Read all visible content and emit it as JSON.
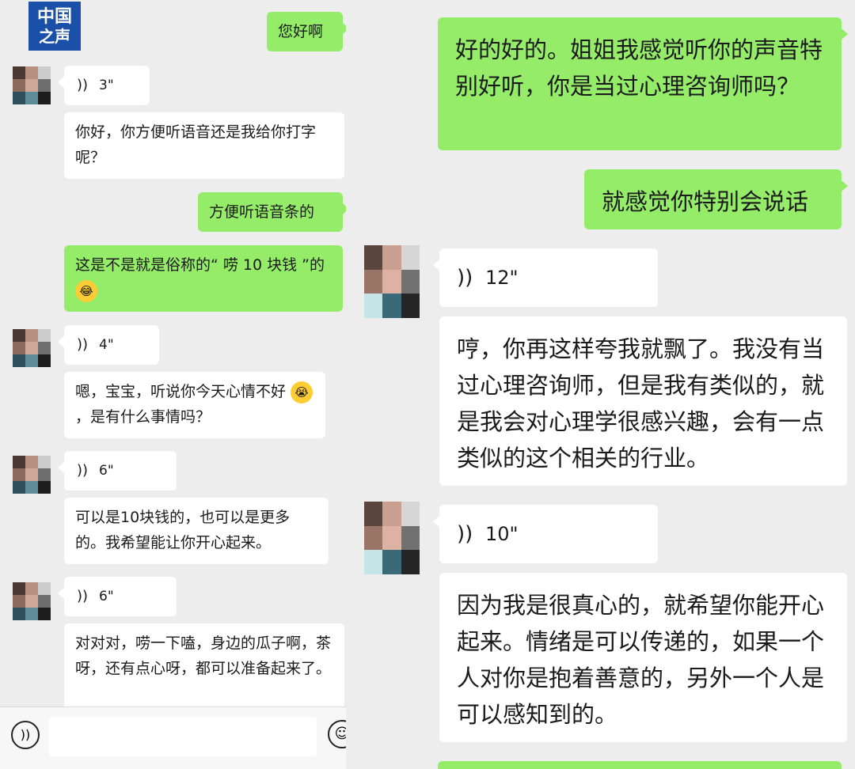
{
  "logo": {
    "line1": "中国",
    "line2": "之声"
  },
  "left_chat": {
    "msg1": "您好啊",
    "voice1": "3\"",
    "msg2": "你好，你方便听语音还是我给你打字呢？",
    "msg3": "方便听语音条的",
    "msg4_text": "这是不是就是俗称的“ 唠 10 块钱 ”的",
    "voice2": "4\"",
    "msg5_text": "嗯，宝宝，听说你今天心情不好",
    "msg5_text2": "，是有什么事情吗？",
    "voice3": "6\"",
    "msg6": "可以是10块钱的，也可以是更多的。我希望能让你开心起来。",
    "voice4": "6\"",
    "msg7": "对对对，唠一下嗑，身边的瓜子啊，茶呀，还有点心呀，都可以准备起来了。"
  },
  "input_bar": {
    "placeholder": ""
  },
  "right_chat": {
    "msg1": "好的好的。姐姐我感觉听你的声音特别好听，你是当过心理咨询师吗？",
    "msg2": "就感觉你特别会说话",
    "voice1": "12\"",
    "msg3": "哼，你再这样夸我就飘了。我没有当过心理咨询师，但是我有类似的，就是我会对心理学很感兴趣，会有一点类似的这个相关的行业。",
    "voice2": "10\"",
    "msg4": "因为我是很真心的，就希望你能开心起来。情绪是可以传递的，如果一个人对你是抱着善意的，另外一个人是可以感知到的。"
  },
  "icons": {
    "voice_wave": "wifi-like-voice-icon",
    "mic": "voice-input-icon",
    "emoji": "emoji-icon"
  },
  "colors": {
    "green_bubble": "#95ec69",
    "white_bubble": "#ffffff",
    "background": "#ededed"
  }
}
